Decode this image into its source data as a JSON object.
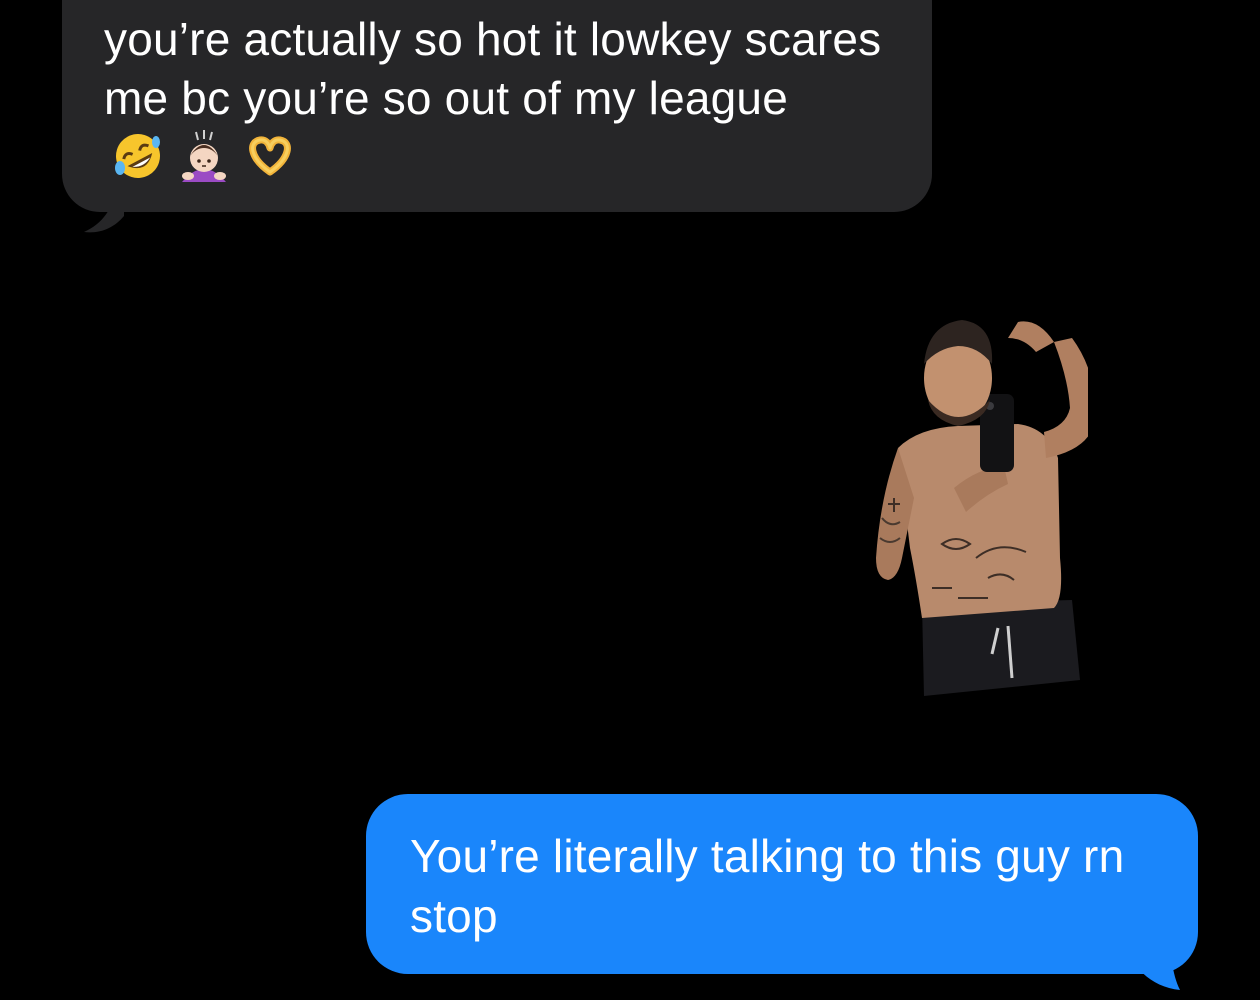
{
  "thread": {
    "incoming_message": {
      "text": "you’re actually so hot it lowkey scares me bc you’re so out of my league",
      "emojis": [
        "rolling-on-floor-laughing-emoji",
        "person-bowing-emoji",
        "heart-hands-emoji"
      ]
    },
    "sticker": {
      "icon": "shirtless-mirror-selfie-sticker"
    },
    "outgoing_message": {
      "text": "You’re literally talking to this guy rn stop"
    }
  },
  "colors": {
    "background": "#000000",
    "incoming_bubble": "#262628",
    "outgoing_bubble": "#1a86fb",
    "text": "#ffffff"
  }
}
